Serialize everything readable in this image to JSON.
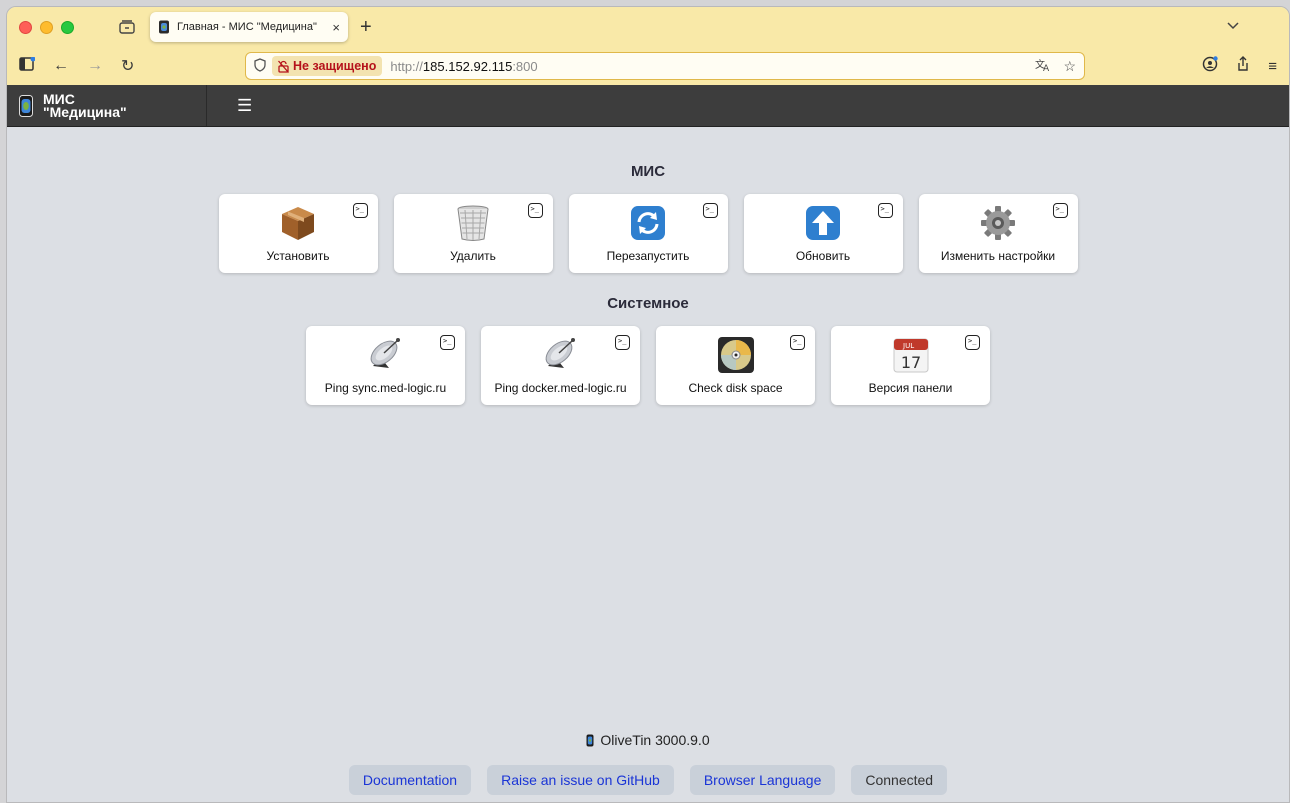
{
  "browser": {
    "tab_title": "Главная - МИС \"Медицина\"",
    "tab_close": "×",
    "new_tab": "+",
    "security_label": "Не защищено",
    "url_protocol": "http://",
    "url_host": "185.152.92.115",
    "url_port": ":800"
  },
  "app": {
    "brand_line1": "МИС",
    "brand_line2": "\"Медицина\"",
    "menu_icon": "hamburger-menu-icon"
  },
  "sections": [
    {
      "title": "МИС",
      "actions": [
        {
          "label": "Установить",
          "icon": "package-box-icon"
        },
        {
          "label": "Удалить",
          "icon": "trash-bin-icon"
        },
        {
          "label": "Перезапустить",
          "icon": "restart-icon"
        },
        {
          "label": "Обновить",
          "icon": "update-arrow-icon"
        },
        {
          "label": "Изменить настройки",
          "icon": "gear-settings-icon"
        }
      ]
    },
    {
      "title": "Системное",
      "actions": [
        {
          "label": "Ping sync.med-logic.ru",
          "icon": "satellite-dish-icon"
        },
        {
          "label": "Ping docker.med-logic.ru",
          "icon": "satellite-dish-icon"
        },
        {
          "label": "Check disk space",
          "icon": "disk-icon"
        },
        {
          "label": "Версия панели",
          "icon": "calendar-icon"
        }
      ]
    }
  ],
  "calendar": {
    "month": "JUL",
    "day": "17"
  },
  "footer": {
    "version": "OliveTin 3000.9.0",
    "links": [
      "Documentation",
      "Raise an issue on GitHub",
      "Browser Language"
    ],
    "status": "Connected"
  },
  "colors": {
    "header_bg": "#3d3d3d",
    "content_bg": "#dcdfe4",
    "browser_chrome": "#f9e9a8",
    "link": "#1a35d6"
  }
}
